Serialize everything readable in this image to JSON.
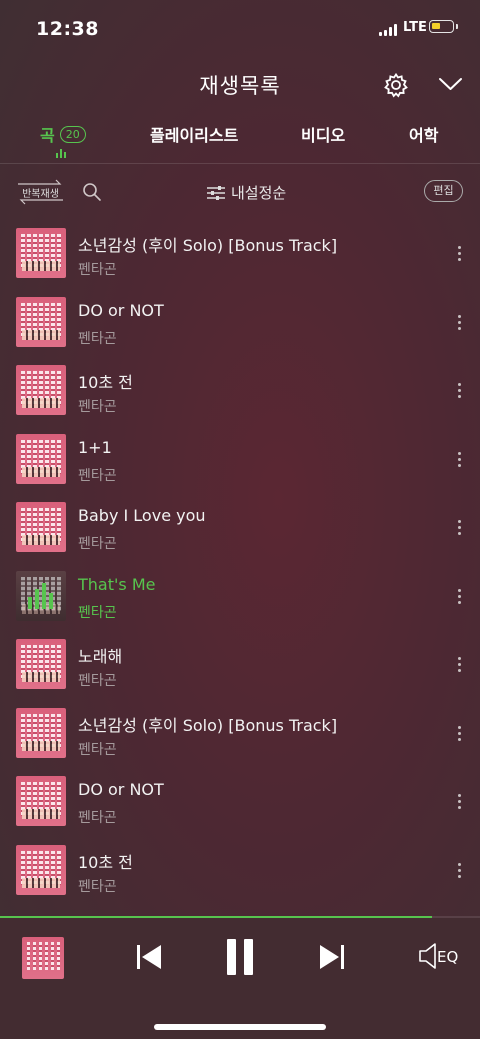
{
  "status": {
    "time": "12:38",
    "network": "LTE",
    "battery_level": 0.4
  },
  "header": {
    "title": "재생목록",
    "settings_icon": "gear-icon",
    "collapse_icon": "chevron-down-icon"
  },
  "tabs": [
    {
      "label": "곡",
      "count": "20",
      "active": true
    },
    {
      "label": "플레이리스트",
      "active": false
    },
    {
      "label": "비디오",
      "active": false
    },
    {
      "label": "어학",
      "active": false
    }
  ],
  "toolbar": {
    "repeat_label": "반복재생",
    "sort_label": "내설정순",
    "edit_label": "편집"
  },
  "songs": [
    {
      "title": "소년감성 (후이 Solo) [Bonus Track]",
      "artist": "펜타곤"
    },
    {
      "title": "DO or NOT",
      "artist": "펜타곤"
    },
    {
      "title": "10초 전",
      "artist": "펜타곤"
    },
    {
      "title": "1+1",
      "artist": "펜타곤"
    },
    {
      "title": "Baby I Love you",
      "artist": "펜타곤"
    },
    {
      "title": "That's Me",
      "artist": "펜타곤",
      "playing": true
    },
    {
      "title": "노래해",
      "artist": "펜타곤"
    },
    {
      "title": "소년감성 (후이 Solo) [Bonus Track]",
      "artist": "펜타곤"
    },
    {
      "title": "DO or NOT",
      "artist": "펜타곤"
    },
    {
      "title": "10초 전",
      "artist": "펜타곤"
    }
  ],
  "player": {
    "progress": 0.9,
    "eq_label": "EQ"
  },
  "colors": {
    "accent": "#57c44e",
    "background": "#4d2833",
    "player_bg": "#432c31"
  }
}
